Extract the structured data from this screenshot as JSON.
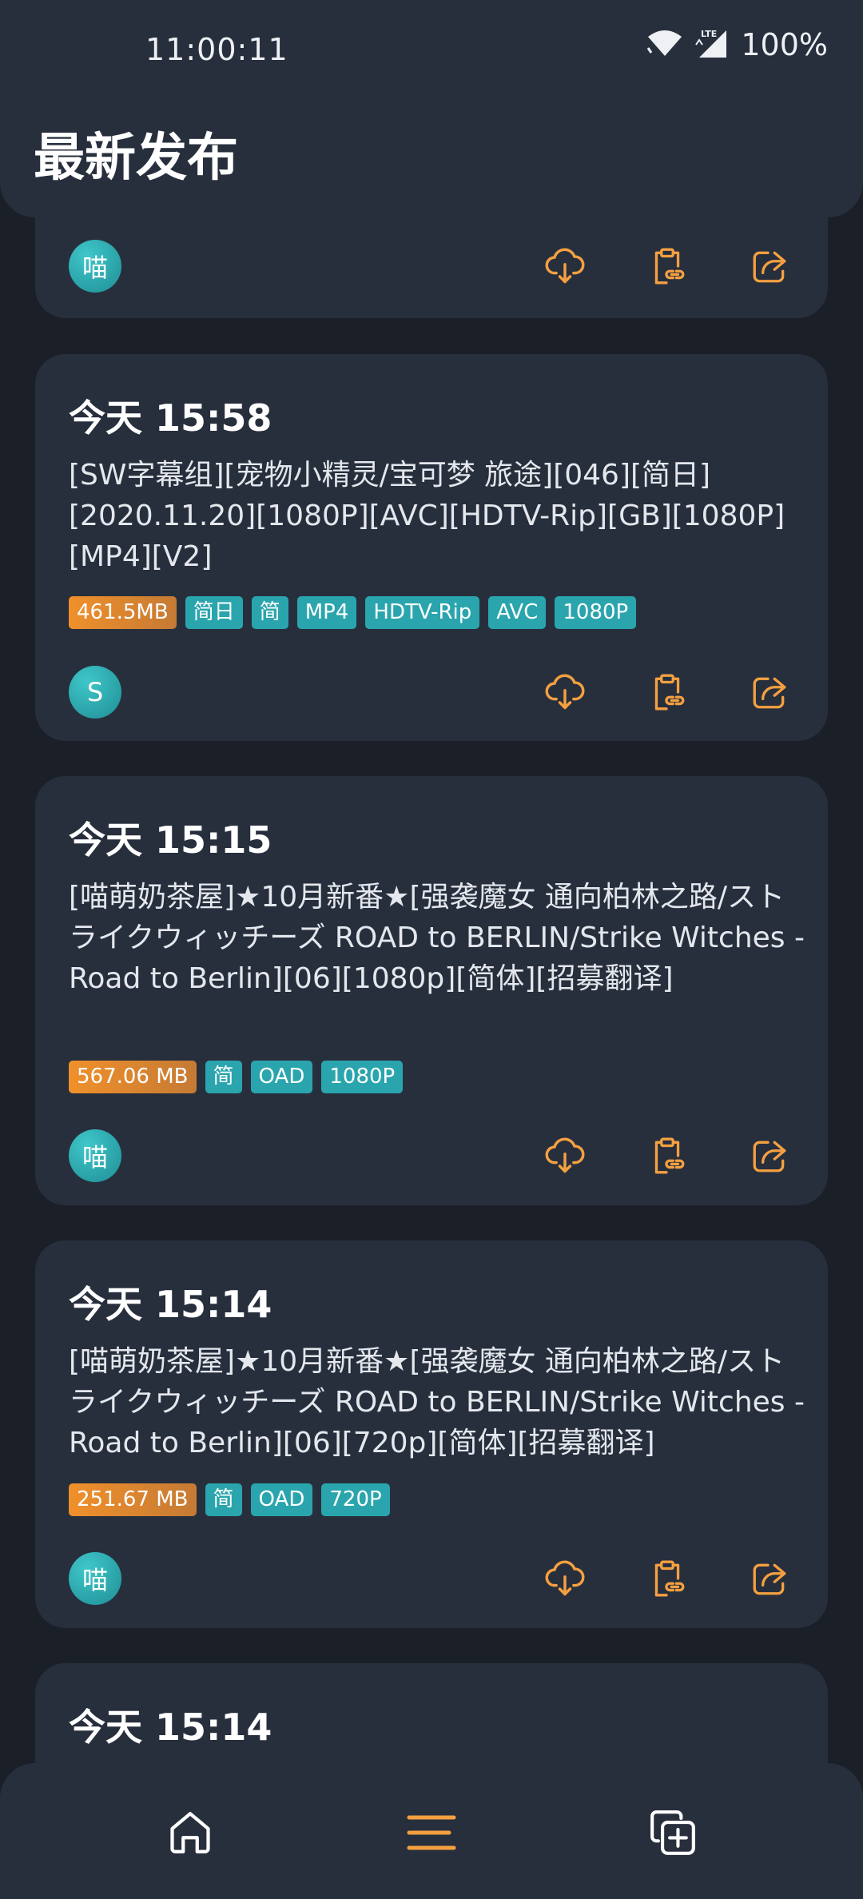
{
  "status_bar": {
    "time": "11:00:11",
    "battery": "100%"
  },
  "header": {
    "title": "最新发布"
  },
  "cards": [
    {
      "avatar": "喵"
    },
    {
      "time": "今天 15:58",
      "title": "[SW字幕组][宠物小精灵/宝可梦 旅途][046][简日][2020.11.20][1080P][AVC][HDTV-Rip][GB][1080P][MP4][V2]",
      "size": "461.5MB",
      "tags": [
        "简日",
        "简",
        "MP4",
        "HDTV-Rip",
        "AVC",
        "1080P"
      ],
      "avatar": "S"
    },
    {
      "time": "今天 15:15",
      "title": "[喵萌奶茶屋]★10月新番★[强袭魔女 通向柏林之路/ストライクウィッチーズ ROAD to BERLIN/Strike Witches - Road to Berlin][06][1080p][简体][招募翻译]",
      "size": "567.06 MB",
      "tags": [
        "简",
        "OAD",
        "1080P"
      ],
      "avatar": "喵"
    },
    {
      "time": "今天 15:14",
      "title": "[喵萌奶茶屋]★10月新番★[强袭魔女 通向柏林之路/ストライクウィッチーズ ROAD to BERLIN/Strike Witches - Road to Berlin][06][720p][简体][招募翻译]",
      "size": "251.67 MB",
      "tags": [
        "简",
        "OAD",
        "720P"
      ],
      "avatar": "喵"
    },
    {
      "time": "今天 15:14"
    }
  ],
  "icons": {
    "download": "cloud-download-icon",
    "copy": "clipboard-link-icon",
    "share": "share-icon",
    "nav": [
      "home-icon",
      "list-icon",
      "add-icon"
    ]
  },
  "colors": {
    "accent": "#f5a040",
    "tag": "#2aa5ad",
    "size_tag": "#f0902b",
    "card": "#272f3d",
    "background": "#1b2028"
  }
}
